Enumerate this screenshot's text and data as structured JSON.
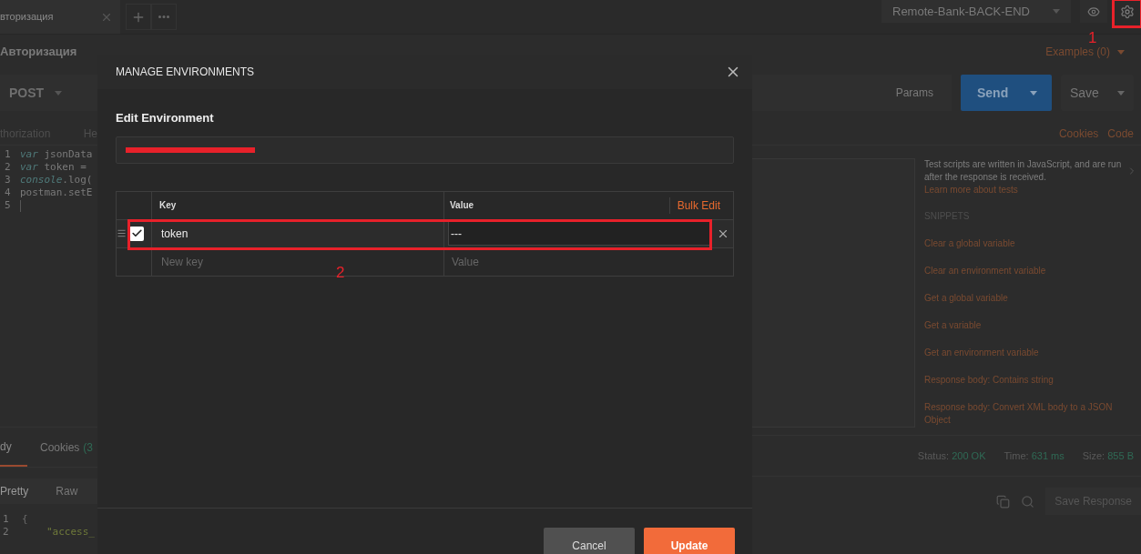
{
  "tabs": [
    {
      "label": "вторизация",
      "selected": true
    }
  ],
  "environment_selector": {
    "value": "Remote-Bank-BACK-END"
  },
  "request": {
    "title": "Авторизация",
    "method": "POST",
    "examples": "Examples (0)",
    "params_button": "Params",
    "send_button": "Send",
    "save_button": "Save"
  },
  "request_tabs": [
    {
      "label": "thorization",
      "selected": false
    },
    {
      "label": "He",
      "selected": false
    }
  ],
  "request_links": [
    "Cookies",
    "Code"
  ],
  "script_lines": [
    {
      "number": "1",
      "keyword": "var",
      "text": " jsonData"
    },
    {
      "number": "2",
      "keyword": "var",
      "text": " token ="
    },
    {
      "number": "3",
      "keyword": "console",
      "text": ".log("
    },
    {
      "number": "4",
      "text": "postman.setE"
    },
    {
      "number": "5"
    }
  ],
  "snippets": {
    "description": "Test scripts are written in JavaScript, and are run after the response is received.",
    "learn_more": "Learn more about tests",
    "heading": "SNIPPETS",
    "items": [
      "Clear a global variable",
      "Clear an environment variable",
      "Get a global variable",
      "Get a variable",
      "Get an environment variable",
      "Response body: Contains string",
      "Response body: Convert XML body to a JSON Object"
    ]
  },
  "response": {
    "tabs": [
      {
        "label": "dy",
        "selected": true
      },
      {
        "label": "Cookies",
        "count": "(3",
        "selected": false
      }
    ],
    "status_label": "Status:",
    "status": "200 OK",
    "time_label": "Time:",
    "time": "631 ms",
    "size_label": "Size:",
    "size": "855 B",
    "views": [
      {
        "label": "Pretty",
        "selected": true
      },
      {
        "label": "Raw",
        "selected": false
      }
    ],
    "save_response": "Save Response",
    "lines": [
      {
        "number": "1",
        "text": "{"
      },
      {
        "number": "2",
        "text": "\"access_"
      }
    ]
  },
  "modal": {
    "title": "MANAGE ENVIRONMENTS",
    "section": "Edit Environment",
    "name_redacted": true,
    "columns": [
      "Key",
      "Value"
    ],
    "bulk_edit": "Bulk Edit",
    "rows": [
      {
        "key": "token",
        "value": "---",
        "checked": true
      }
    ],
    "new_row": {
      "key_placeholder": "New key",
      "value_placeholder": "Value"
    },
    "cancel": "Cancel",
    "update": "Update"
  },
  "annotations": [
    {
      "label": "1"
    },
    {
      "label": "2"
    }
  ]
}
